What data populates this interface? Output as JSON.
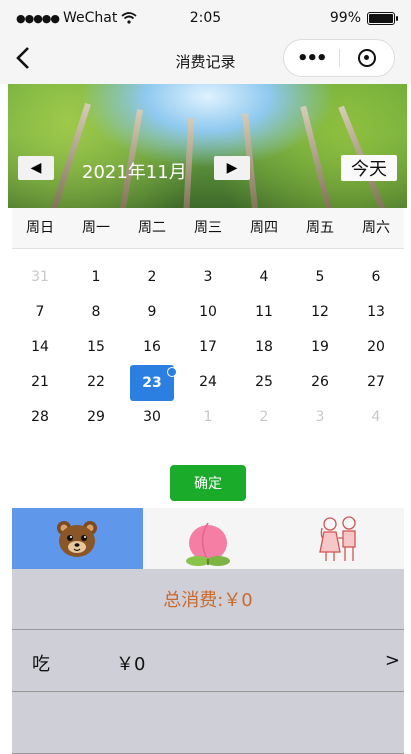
{
  "status": {
    "carrier": "WeChat",
    "time": "2:05",
    "battery": "99%",
    "battery_level": 0.99
  },
  "nav": {
    "title": "消费记录",
    "more": "•••"
  },
  "calendar": {
    "month_label": "2021年11月",
    "prev": "◀",
    "next": "▶",
    "today_label": "今天",
    "weekdays": [
      "周日",
      "周一",
      "周二",
      "周三",
      "周四",
      "周五",
      "周六"
    ],
    "weeks": [
      [
        "31",
        "1",
        "2",
        "3",
        "4",
        "5",
        "6"
      ],
      [
        "7",
        "8",
        "9",
        "10",
        "11",
        "12",
        "13"
      ],
      [
        "14",
        "15",
        "16",
        "17",
        "18",
        "19",
        "20"
      ],
      [
        "21",
        "22",
        "23",
        "24",
        "25",
        "26",
        "27"
      ],
      [
        "28",
        "29",
        "30",
        "1",
        "2",
        "3",
        "4"
      ]
    ],
    "selected_day": "23"
  },
  "confirm_label": "确定",
  "tabs": [
    {
      "icon": "bear-icon",
      "active": true
    },
    {
      "icon": "peach-icon",
      "active": false
    },
    {
      "icon": "couple-icon",
      "active": false
    }
  ],
  "summary": {
    "label": "总消费:￥0"
  },
  "records": [
    {
      "category": "吃",
      "amount": "￥0",
      "chevron": ">"
    },
    {
      "category": "",
      "amount": "",
      "chevron": ""
    }
  ],
  "colors": {
    "accent": "#2b7fe0",
    "confirm": "#1aab2b",
    "active_tab": "#5f97ea",
    "summary_text": "#c96a2e"
  }
}
